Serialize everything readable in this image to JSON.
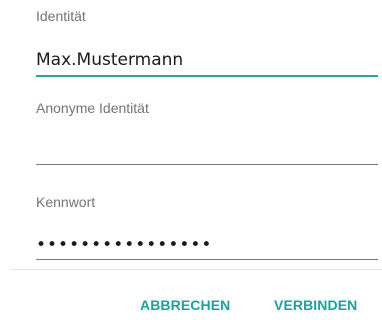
{
  "form": {
    "identity_label": "Identität",
    "identity_value": "Max.Mustermann",
    "anonymous_identity_label": "Anonyme Identität",
    "anonymous_identity_value": "",
    "password_label": "Kennwort",
    "password_value": "••••••••••••••••",
    "accent_color": "#26a6a0"
  },
  "actions": {
    "cancel_label": "ABBRECHEN",
    "connect_label": "VERBINDEN",
    "button_color": "#1aa39b"
  }
}
